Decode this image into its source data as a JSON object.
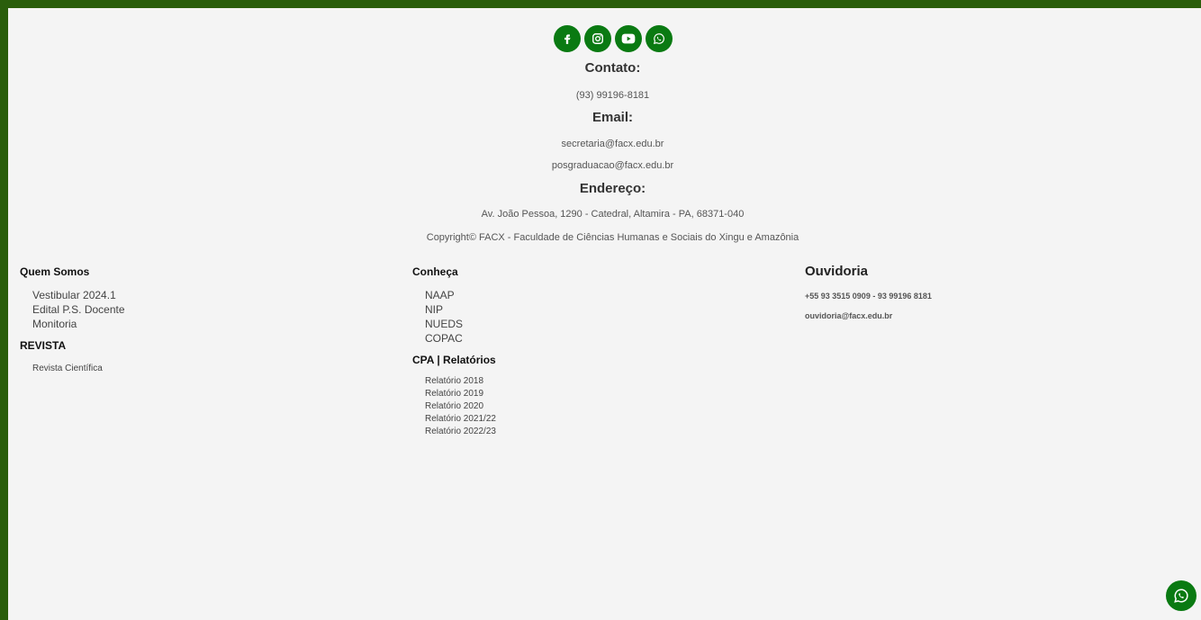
{
  "colors": {
    "frame": "#2a5e0c",
    "accent": "#0a7a12",
    "background": "#f4f4f4"
  },
  "social": {
    "icons": [
      "facebook-icon",
      "instagram-icon",
      "youtube-icon",
      "whatsapp-icon"
    ]
  },
  "contact": {
    "title": "Contato:",
    "phone": "(93) 99196-8181"
  },
  "email": {
    "title": "Email:",
    "items": [
      "secretaria@facx.edu.br",
      "posgraduacao@facx.edu.br"
    ]
  },
  "address": {
    "title": "Endereço:",
    "text": "Av. João Pessoa, 1290 - Catedral, Altamira - PA, 68371-040"
  },
  "copyright": "Copyright© FACX - Faculdade de Ciências Humanas e Sociais do Xingu e Amazônia",
  "quem_somos": {
    "title": "Quem Somos",
    "items": [
      "Vestibular 2024.1",
      "Edital P.S. Docente",
      "Monitoria"
    ]
  },
  "revista": {
    "title": "REVISTA",
    "items": [
      "Revista Científica"
    ]
  },
  "conheca": {
    "title": "Conheça",
    "items": [
      "NAAP",
      "NIP",
      "NUEDS",
      "COPAC"
    ]
  },
  "cpa": {
    "title": "CPA | Relatórios",
    "items": [
      "Relatório 2018",
      "Relatório 2019",
      "Relatório 2020",
      "Relatório 2021/22",
      "Relatório 2022/23"
    ]
  },
  "ouvidoria": {
    "title": "Ouvidoria",
    "phone": "+55 93 3515 0909 - 93 99196 8181",
    "email": "ouvidoria@facx.edu.br"
  },
  "floating_whatsapp": {
    "icon": "whatsapp-icon"
  }
}
